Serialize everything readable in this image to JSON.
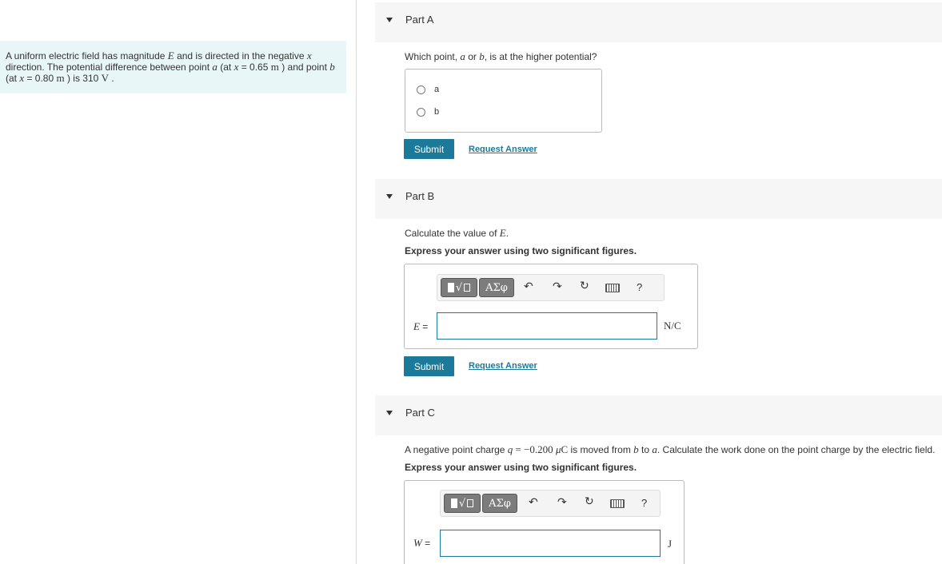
{
  "problem": {
    "t1": "A uniform electric field has magnitude ",
    "E": "E",
    "t2": " and is directed in the negative ",
    "x1": "x",
    "t3": "direction. The potential difference between point ",
    "a": "a",
    "t4": " (at ",
    "x2": "x",
    "eq1": " = 0.65 ",
    "m1": "m",
    "t5": " ) and point ",
    "b": "b",
    "t6": "(at ",
    "x3": "x",
    "eq2": " = 0.80 ",
    "m2": "m",
    "t7": " ) is 310 ",
    "V": "V",
    "t8": " ."
  },
  "partA": {
    "title": "Part A",
    "q1": "Which point, ",
    "qa": "a",
    "q2": " or ",
    "qb": "b",
    "q3": ", is at the higher potential?",
    "options": [
      "a",
      "b"
    ],
    "submit": "Submit",
    "request": "Request Answer"
  },
  "partB": {
    "title": "Part B",
    "q1": "Calculate the value of ",
    "qE": "E",
    "q2": ".",
    "instruction": "Express your answer using two significant figures.",
    "greek": "ΑΣφ",
    "help": "?",
    "var": "E",
    "eq": " =",
    "unit": "N/C",
    "submit": "Submit",
    "request": "Request Answer"
  },
  "partC": {
    "title": "Part C",
    "q1": "A negative point charge ",
    "qq": "q",
    "qeq": " = −0.200 ",
    "qmu": "μ",
    "qC": "C",
    "q2": " is moved from ",
    "qb": "b",
    "q3": " to ",
    "qa": "a",
    "q4": ". Calculate the work done on the point charge by the electric field.",
    "instruction": "Express your answer using two significant figures.",
    "greek": "ΑΣφ",
    "help": "?",
    "var": "W",
    "eq": " =",
    "unit": "J"
  },
  "toolbar_icons": [
    "templates-icon",
    "greek-symbols-icon",
    "undo-icon",
    "redo-icon",
    "reset-icon",
    "keyboard-icon",
    "help-icon"
  ]
}
